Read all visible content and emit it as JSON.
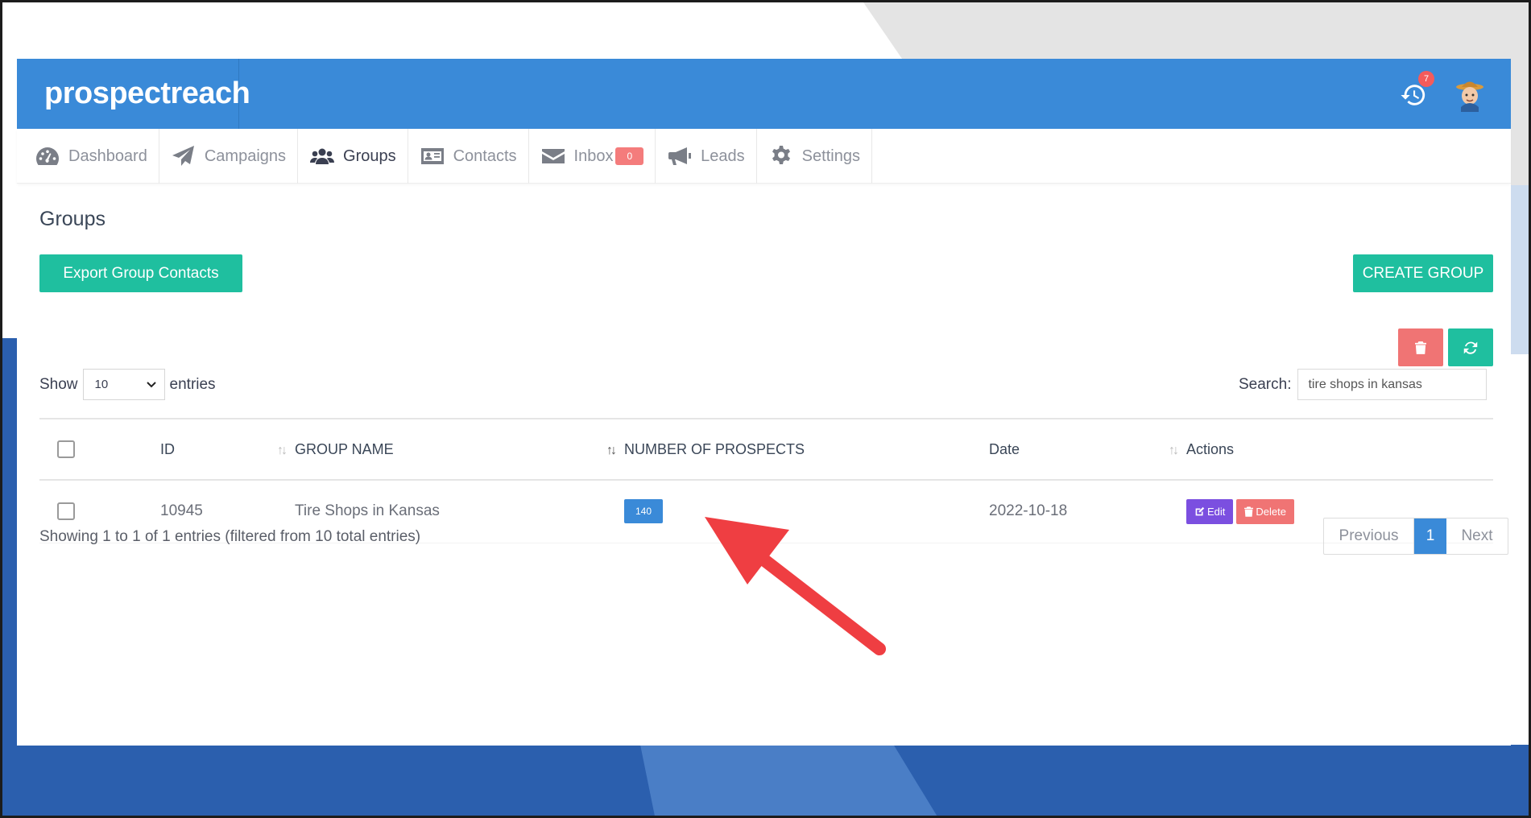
{
  "app": {
    "logo": "prospectreach",
    "notification_count": "7"
  },
  "nav": [
    {
      "label": "Dashboard",
      "icon": "dashboard-icon"
    },
    {
      "label": "Campaigns",
      "icon": "paper-plane-icon"
    },
    {
      "label": "Groups",
      "icon": "users-icon",
      "active": true
    },
    {
      "label": "Contacts",
      "icon": "id-card-icon"
    },
    {
      "label": "Inbox",
      "icon": "envelope-icon",
      "badge": "0"
    },
    {
      "label": "Leads",
      "icon": "megaphone-icon"
    },
    {
      "label": "Settings",
      "icon": "gear-icon"
    }
  ],
  "page": {
    "title": "Groups",
    "export_label": "Export Group Contacts",
    "create_label": "CREATE GROUP"
  },
  "table_controls": {
    "show_label": "Show",
    "entries_value": "10",
    "entries_label": "entries",
    "search_label": "Search:",
    "search_value": "tire shops in kansas"
  },
  "table": {
    "headers": [
      "ID",
      "GROUP NAME",
      "NUMBER OF PROSPECTS",
      "Date",
      "Actions"
    ],
    "rows": [
      {
        "id": "10945",
        "name": "Tire Shops in Kansas",
        "prospects": "140",
        "date": "2022-10-18"
      }
    ],
    "edit_label": "Edit",
    "delete_label": "Delete"
  },
  "footer": {
    "info": "Showing 1 to 1 of 1 entries (filtered from 10 total entries)",
    "prev": "Previous",
    "page": "1",
    "next": "Next"
  },
  "colors": {
    "header": "#3a8ad8",
    "teal": "#1fbf9f",
    "red": "#f07474",
    "purple": "#7b4fe0",
    "arrow": "#ef3e42"
  }
}
